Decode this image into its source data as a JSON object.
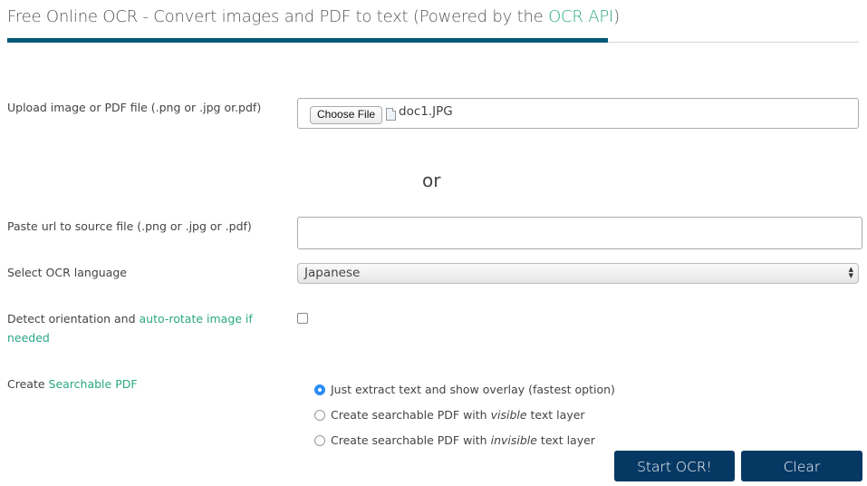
{
  "header": {
    "title_prefix": "Free Online OCR - Convert images and PDF to text (Powered by the ",
    "title_link": "OCR API",
    "title_suffix": ")"
  },
  "upload": {
    "label": "Upload image or PDF file (.png or .jpg or.pdf)",
    "choose_button": "Choose File",
    "file_icon": "file-icon",
    "file_name": "doc1.JPG"
  },
  "divider_text": "or",
  "url": {
    "label": "Paste url to source file (.png or .jpg or .pdf)",
    "value": "",
    "placeholder": ""
  },
  "language": {
    "label": "Select OCR language",
    "selected": "Japanese"
  },
  "orientation": {
    "label_prefix": "Detect orientation and ",
    "label_link": "auto-rotate image if needed",
    "checked": false
  },
  "searchable_pdf": {
    "label_prefix": "Create ",
    "label_link": "Searchable PDF",
    "options": [
      {
        "pre": "Just extract text and show overlay (fastest option)",
        "em": "",
        "post": "",
        "selected": true
      },
      {
        "pre": "Create searchable PDF with ",
        "em": "visible",
        "post": " text layer",
        "selected": false
      },
      {
        "pre": "Create searchable PDF with ",
        "em": "invisible",
        "post": " text layer",
        "selected": false
      }
    ]
  },
  "actions": {
    "start_label": "Start OCR!",
    "clear_label": "Clear"
  },
  "colors": {
    "accent_link": "#2aa884",
    "header_bar": "#005a78",
    "button_bg": "#063864",
    "radio_selected": "#2b8cf5"
  }
}
